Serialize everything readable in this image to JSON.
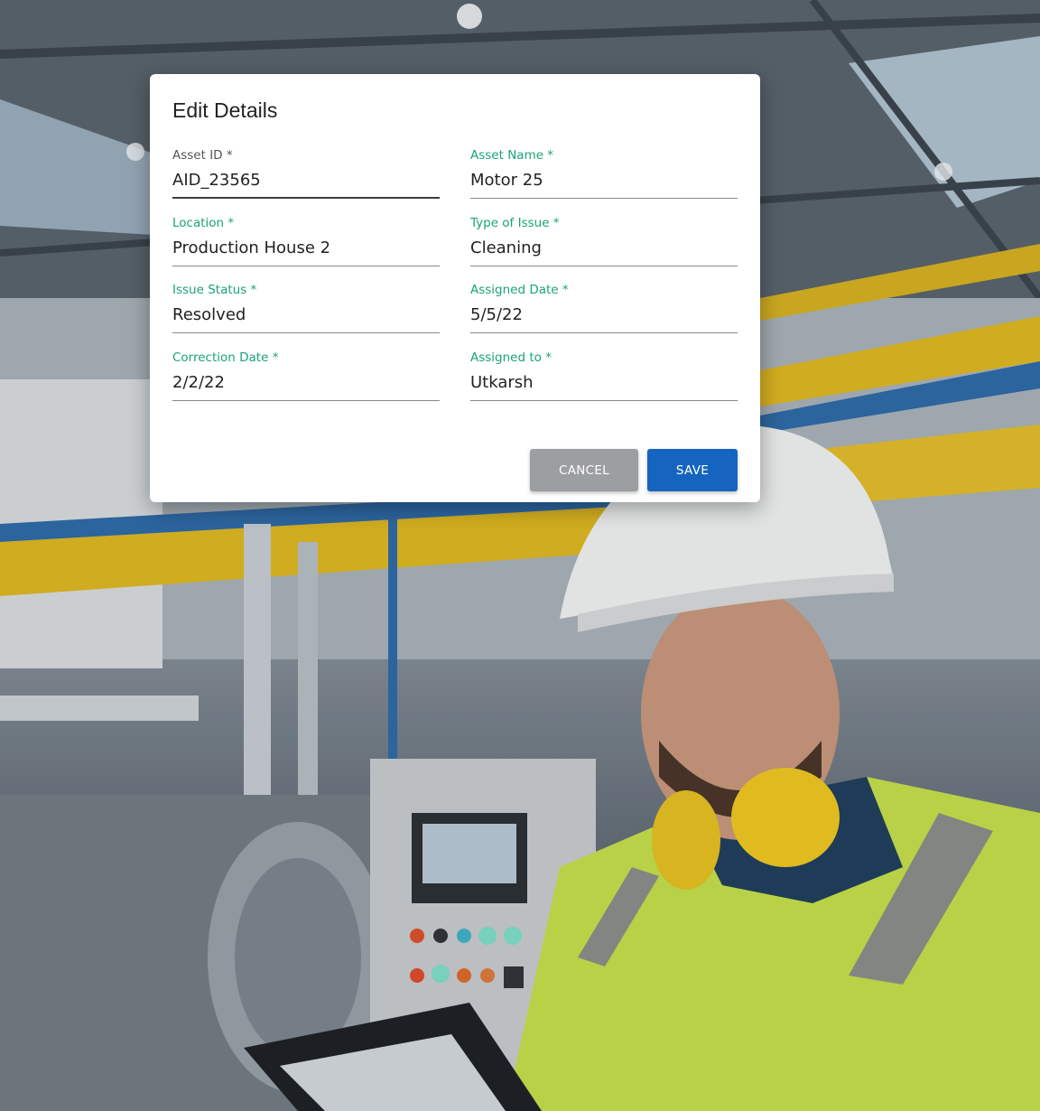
{
  "dialog": {
    "title": "Edit Details",
    "fields": [
      {
        "label": "Asset ID *",
        "value": "AID_23565"
      },
      {
        "label": "Asset Name *",
        "value": "Motor 25"
      },
      {
        "label": "Location *",
        "value": "Production House 2"
      },
      {
        "label": "Type of Issue *",
        "value": "Cleaning"
      },
      {
        "label": "Issue Status *",
        "value": "Resolved"
      },
      {
        "label": "Assigned Date *",
        "value": "5/5/22"
      },
      {
        "label": "Correction Date *",
        "value": "2/2/22"
      },
      {
        "label": "Assigned to *",
        "value": "Utkarsh"
      }
    ],
    "cancel_label": "CANCEL",
    "save_label": "SAVE"
  },
  "colors": {
    "label_accent": "#1aa37a",
    "save_button": "#1565c0",
    "cancel_button": "#9c9ea1"
  }
}
